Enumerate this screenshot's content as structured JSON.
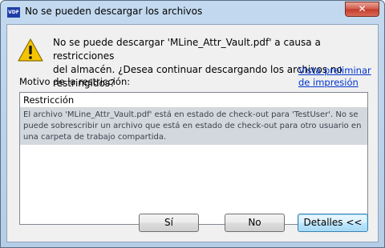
{
  "window": {
    "title": "No se pueden descargar los archivos",
    "app_icon_text": "VDF",
    "close_label": "✕"
  },
  "message": {
    "icon": "warning-icon",
    "text": "No se puede descargar 'MLine_Attr_Vault.pdf' a causa a restricciones\ndel almacén. ¿Desea continuar descargando los archivos no restringidos?"
  },
  "preview_link": "Vista preliminar de impresión",
  "reason_label": "Motivo de la restricción:",
  "restrictions": {
    "column_header": "Restricción",
    "rows": [
      "El archivo 'MLine_Attr_Vault.pdf' está en estado de check-out para 'TestUser'. No se puede sobrescribir un archivo que está en estado de check-out para otro usuario en una carpeta de trabajo compartida."
    ]
  },
  "buttons": {
    "yes": "Sí",
    "no": "No",
    "details": "Detalles <<"
  },
  "colors": {
    "link": "#0033cc",
    "selected_row": "#d3d8de",
    "warning_yellow": "#f5c400"
  }
}
